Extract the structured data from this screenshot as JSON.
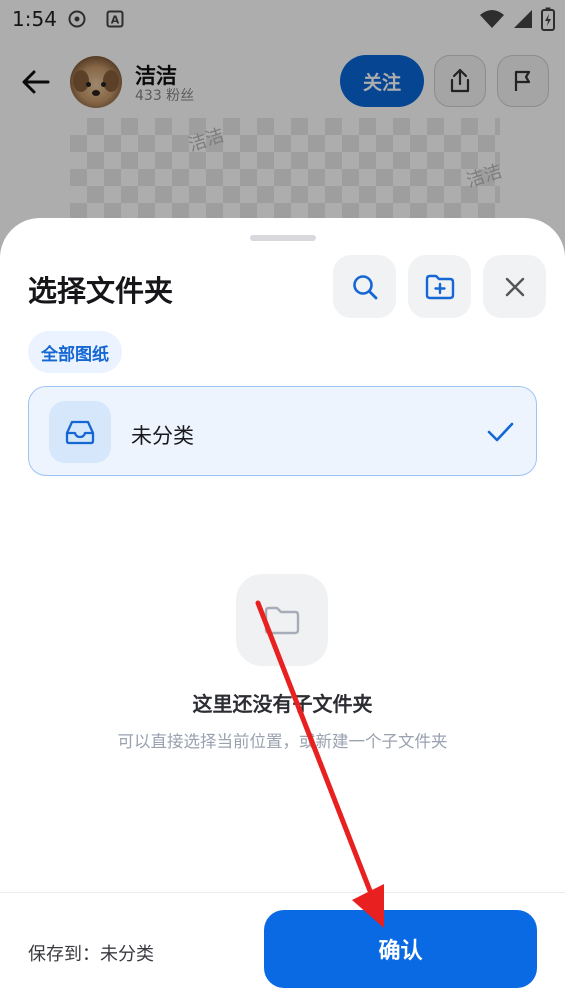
{
  "status_bar": {
    "time": "1:54",
    "icons_left": [
      "media-icon",
      "a-badge-icon"
    ],
    "icons_right": [
      "wifi-icon",
      "signal-icon",
      "battery-charging-icon"
    ]
  },
  "profile_header": {
    "user_name": "洁洁",
    "fans_text": "433 粉丝",
    "follow_label": "关注",
    "watermark_text": "洁洁"
  },
  "sheet": {
    "title": "选择文件夹",
    "breadcrumb": "全部图纸",
    "folders": [
      {
        "label": "未分类",
        "selected": true
      }
    ],
    "empty_title": "这里还没有子文件夹",
    "empty_subtitle": "可以直接选择当前位置，或新建一个子文件夹",
    "save_to_prefix": "保存到：",
    "save_to_value": "未分类",
    "confirm_label": "确认"
  },
  "colors": {
    "accent": "#0a6ae4",
    "follow": "#0a66d8",
    "selected_bg": "#edf4fe",
    "selected_border": "#9ec4f2",
    "annotation_arrow": "#e8201f"
  }
}
